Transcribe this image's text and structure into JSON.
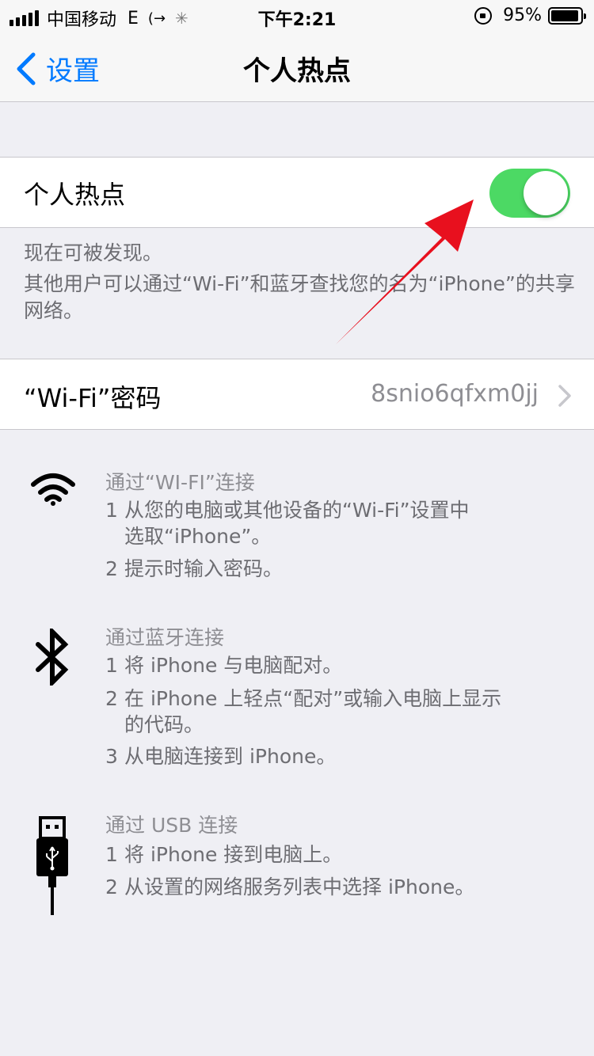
{
  "status_bar": {
    "carrier": "中国移动",
    "network": "E",
    "time": "下午2:21",
    "battery_percent": "95%",
    "battery_level": 0.95
  },
  "nav": {
    "back_label": "设置",
    "title": "个人热点"
  },
  "hotspot": {
    "label": "个人热点",
    "enabled": true
  },
  "discover": {
    "line1": "现在可被发现。",
    "line2": "其他用户可以通过“Wi-Fi”和蓝牙查找您的名为“iPhone”的共享网络。"
  },
  "wifi_password": {
    "label": "“Wi-Fi”密码",
    "value": "8snio6qfxm0jj"
  },
  "instructions": {
    "wifi": {
      "title": "通过“WI-FI”连接",
      "steps": [
        {
          "num": "1",
          "text": "从您的电脑或其他设备的“Wi-Fi”设置中",
          "cont": "选取“iPhone”。"
        },
        {
          "num": "2",
          "text": "提示时输入密码。"
        }
      ]
    },
    "bluetooth": {
      "title": "通过蓝牙连接",
      "steps": [
        {
          "num": "1",
          "text": "将 iPhone 与电脑配对。"
        },
        {
          "num": "2",
          "text": "在 iPhone 上轻点“配对”或输入电脑上显示",
          "cont": "的代码。"
        },
        {
          "num": "3",
          "text": "从电脑连接到 iPhone。"
        }
      ]
    },
    "usb": {
      "title": "通过 USB 连接",
      "steps": [
        {
          "num": "1",
          "text": "将 iPhone 接到电脑上。"
        },
        {
          "num": "2",
          "text": "从设置的网络服务列表中选择 iPhone。"
        }
      ]
    }
  },
  "colors": {
    "accent": "#007aff",
    "toggle_on": "#4cd964",
    "annotation_arrow": "#e8101e"
  },
  "icons": [
    "signal-icon",
    "call-forward-icon",
    "loading-spinner-icon",
    "rotation-lock-icon",
    "battery-icon",
    "chevron-left-icon",
    "chevron-right-icon",
    "wifi-icon",
    "bluetooth-icon",
    "usb-icon"
  ]
}
